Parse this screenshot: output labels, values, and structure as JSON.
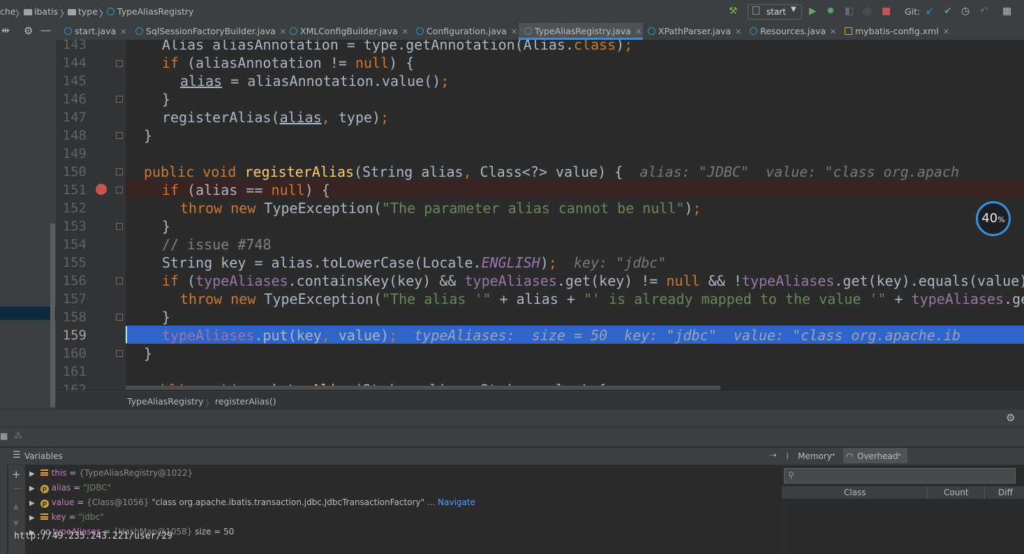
{
  "navbar": {
    "crumbs": [
      "che",
      "ibatis",
      "type",
      "TypeAliasRegistry"
    ],
    "run_config": "start",
    "git_label": "Git:"
  },
  "tabs": [
    {
      "label": "start.java",
      "active": false
    },
    {
      "label": "SqlSessionFactoryBuilder.java",
      "active": false
    },
    {
      "label": "XMLConfigBuilder.java",
      "active": false
    },
    {
      "label": "Configuration.java",
      "active": false
    },
    {
      "label": "TypeAliasRegistry.java",
      "active": true
    },
    {
      "label": "XPathParser.java",
      "active": false
    },
    {
      "label": "Resources.java",
      "active": false
    },
    {
      "label": "mybatis-config.xml",
      "active": false
    }
  ],
  "editor": {
    "line_numbers": [
      "143",
      "144",
      "145",
      "146",
      "147",
      "148",
      "149",
      "150",
      "151",
      "152",
      "153",
      "154",
      "155",
      "156",
      "157",
      "158",
      "159",
      "160",
      "161",
      "162"
    ],
    "current_line": "159",
    "breakpoint_line": "151",
    "hints": {
      "l150": "alias: \"JDBC\"  value: \"class org.apach",
      "l155": "key: \"jdbc\"",
      "l159": "typeAliases:  size = 50  key: \"jdbc\"  value: \"class org.apache.ib"
    }
  },
  "editor_breadcrumb": {
    "class": "TypeAliasRegistry",
    "method": "registerAlias()"
  },
  "cpu_gauge": {
    "value": "40",
    "unit": "%"
  },
  "variables": {
    "title": "Variables",
    "items": [
      {
        "name": "this",
        "eq": " = ",
        "ref": "{TypeAliasRegistry@1022}",
        "val": "",
        "extra": ""
      },
      {
        "name": "alias",
        "eq": " = ",
        "ref": "",
        "val": "\"JDBC\"",
        "extra": ""
      },
      {
        "name": "value",
        "eq": " = ",
        "ref": "{Class@1056}",
        "val": " \"class org.apache.ibatis.transaction.jdbc.JdbcTransactionFactory\"",
        "extra": " ... Navigate"
      },
      {
        "name": "key",
        "eq": " = ",
        "ref": "",
        "val": "\"jdbc\"",
        "extra": ""
      },
      {
        "name": "typeAliases",
        "eq": " = ",
        "ref": "{HashMap@1058}",
        "val": "  size = 50",
        "extra": ""
      }
    ],
    "url_overlay": "http://49.235.243.221/user/29"
  },
  "memory": {
    "tab_memory": "Memory",
    "tab_overhead": "Overhead",
    "columns": [
      "Class",
      "Count",
      "Diff"
    ]
  }
}
